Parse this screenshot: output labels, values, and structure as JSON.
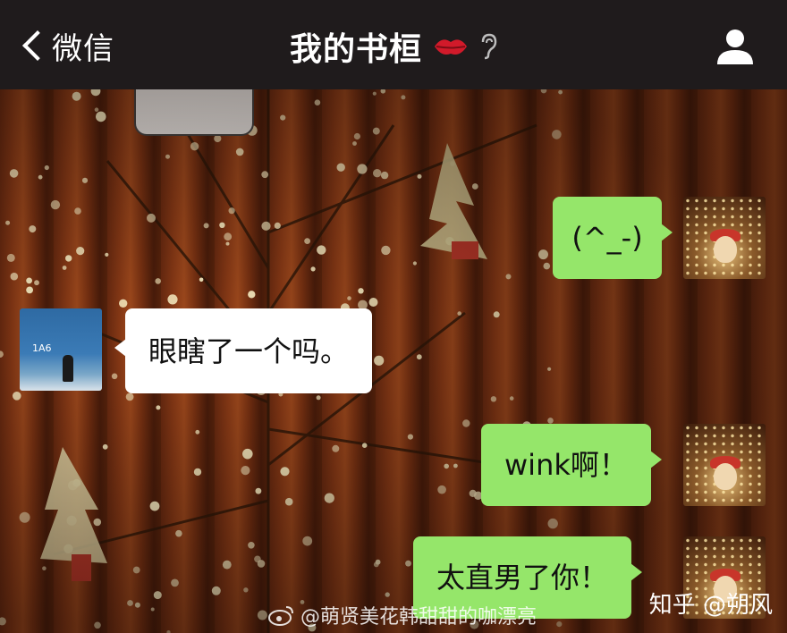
{
  "header": {
    "back_label": "微信",
    "title": "我的书桓"
  },
  "messages": [
    {
      "side": "right",
      "text": "(^_-)"
    },
    {
      "side": "left",
      "text": "眼瞎了一个吗。"
    },
    {
      "side": "right",
      "text": "wink啊！"
    },
    {
      "side": "right",
      "text": "太直男了你！"
    }
  ],
  "watermark": {
    "left": "@萌贤美花韩甜甜的咖漂亮",
    "right": "知乎 @朔风"
  },
  "colors": {
    "header_bg": "#1f1b1c",
    "bubble_green": "#95e66a",
    "bubble_white": "#ffffff"
  },
  "icons": [
    "chevron-left-icon",
    "lips-icon",
    "ear-icon",
    "person-icon",
    "weibo-icon"
  ]
}
